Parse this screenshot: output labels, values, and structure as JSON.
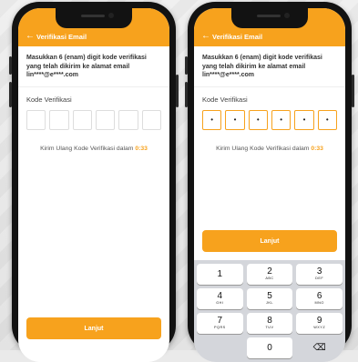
{
  "header": {
    "back_icon": "arrow-left-icon",
    "title": "Verifikasi Email"
  },
  "instruction": "Masukkan 6 (enam) digit kode verifikasi yang telah dikirim ke alamat email lin****@e****.com",
  "code_label": "Kode Verifikasi",
  "resend_text": "Kirim Ulang Kode Verifikasi dalam",
  "timer": "0:33",
  "continue_label": "Lanjut",
  "code_mask": "•",
  "accent_color": "#f7a21d",
  "keypad": [
    [
      {
        "num": "1",
        "let": ""
      },
      {
        "num": "2",
        "let": "ABC"
      },
      {
        "num": "3",
        "let": "DEF"
      }
    ],
    [
      {
        "num": "4",
        "let": "GHI"
      },
      {
        "num": "5",
        "let": "JKL"
      },
      {
        "num": "6",
        "let": "MNO"
      }
    ],
    [
      {
        "num": "7",
        "let": "PQRS"
      },
      {
        "num": "8",
        "let": "TUV"
      },
      {
        "num": "9",
        "let": "WXYZ"
      }
    ],
    [
      {
        "num": "",
        "let": ""
      },
      {
        "num": "0",
        "let": ""
      },
      {
        "num": "⌫",
        "let": ""
      }
    ]
  ]
}
